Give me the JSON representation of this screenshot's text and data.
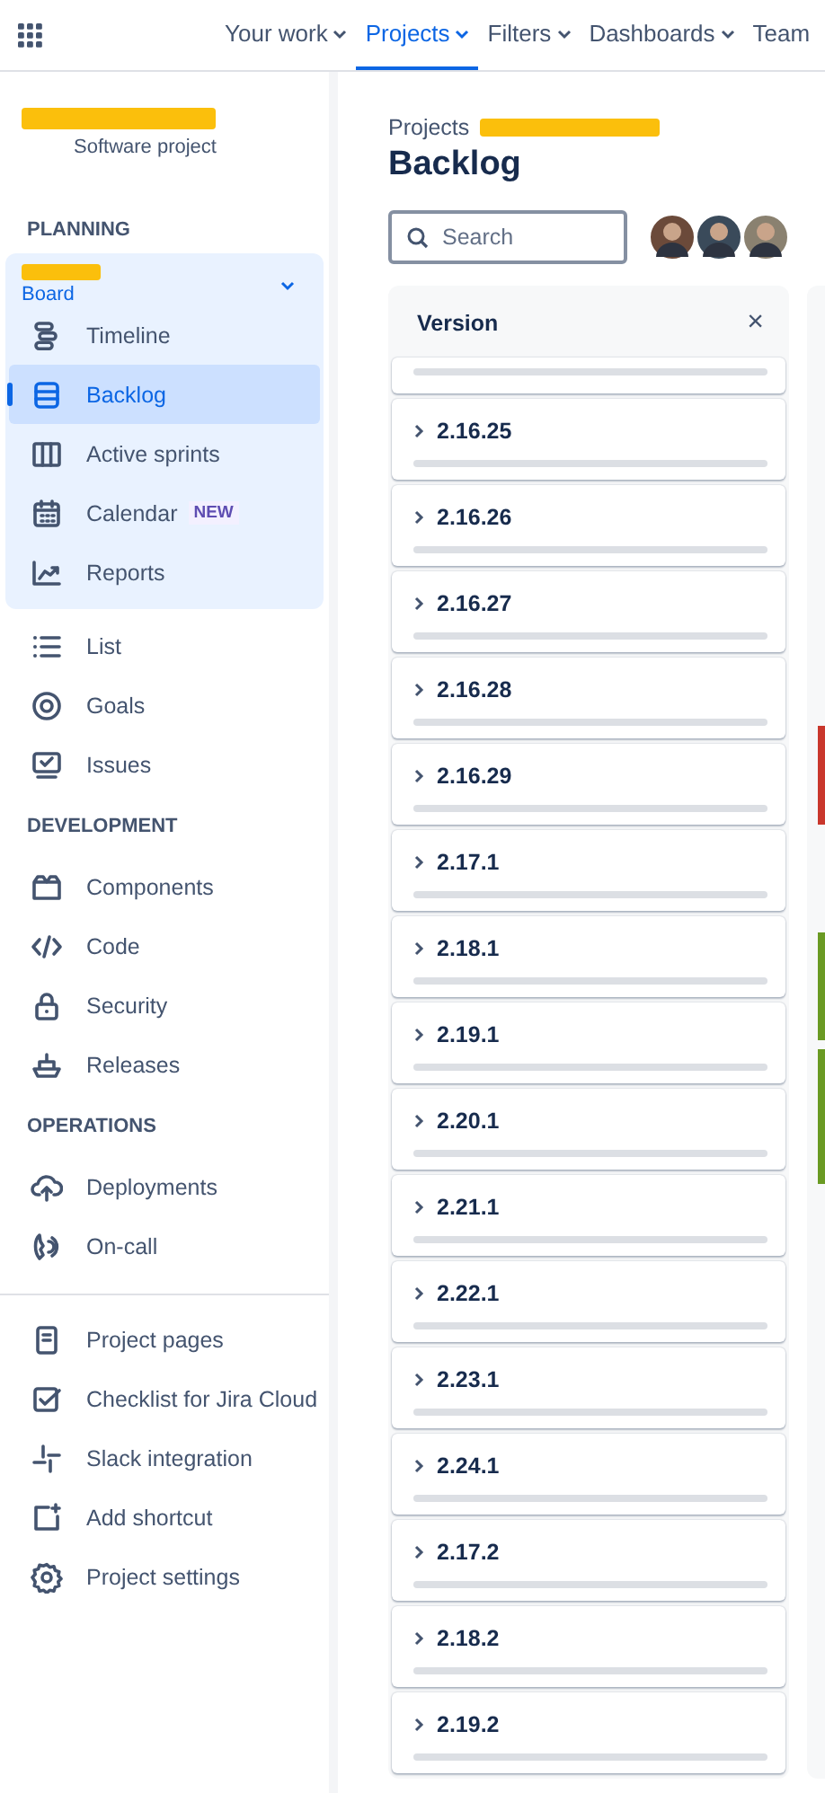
{
  "nav": {
    "items": [
      {
        "label": "Your work",
        "selected": false
      },
      {
        "label": "Projects",
        "selected": true
      },
      {
        "label": "Filters",
        "selected": false
      },
      {
        "label": "Dashboards",
        "selected": false
      },
      {
        "label": "Team",
        "selected": false
      }
    ]
  },
  "sidebar": {
    "project_type": "Software project",
    "sections": [
      {
        "heading": "PLANNING",
        "board": "Board",
        "items": [
          {
            "label": "Timeline",
            "selected": false
          },
          {
            "label": "Backlog",
            "selected": true
          },
          {
            "label": "Active sprints",
            "selected": false
          },
          {
            "label": "Calendar",
            "badge": "NEW",
            "selected": false
          },
          {
            "label": "Reports",
            "selected": false
          }
        ]
      },
      {
        "items": [
          {
            "label": "List",
            "selected": false
          },
          {
            "label": "Goals",
            "selected": false
          },
          {
            "label": "Issues",
            "selected": false
          }
        ]
      },
      {
        "heading": "DEVELOPMENT",
        "items": [
          {
            "label": "Components",
            "selected": false
          },
          {
            "label": "Code",
            "selected": false
          },
          {
            "label": "Security",
            "selected": false
          },
          {
            "label": "Releases",
            "selected": false
          }
        ]
      },
      {
        "heading": "OPERATIONS",
        "items": [
          {
            "label": "Deployments",
            "selected": false
          },
          {
            "label": "On-call",
            "selected": false
          }
        ]
      },
      {
        "divider": true,
        "items": [
          {
            "label": "Project pages",
            "selected": false
          },
          {
            "label": "Checklist for Jira Cloud",
            "selected": false
          },
          {
            "label": "Slack integration",
            "selected": false
          },
          {
            "label": "Add shortcut",
            "selected": false
          },
          {
            "label": "Project settings",
            "selected": false
          }
        ]
      }
    ]
  },
  "breadcrumb": "Projects",
  "title": "Backlog",
  "search": {
    "placeholder": "Search"
  },
  "version_panel": {
    "title": "Version",
    "close": "×",
    "versions": [
      {
        "level": 0
      },
      {
        "name": "2.16.25",
        "level": 0
      },
      {
        "name": "2.16.26",
        "level": 0
      },
      {
        "name": "2.16.27",
        "level": 0
      },
      {
        "name": "2.16.28",
        "level": 0
      },
      {
        "name": "2.16.29",
        "level": 0
      },
      {
        "name": "2.17.1",
        "level": 0
      },
      {
        "name": "2.18.1",
        "level": 0
      },
      {
        "name": "2.19.1",
        "level": 0
      },
      {
        "name": "2.20.1",
        "level": 0
      },
      {
        "name": "2.21.1",
        "level": 0
      },
      {
        "name": "2.22.1",
        "level": 0
      },
      {
        "name": "2.23.1",
        "level": 0
      },
      {
        "name": "2.24.1",
        "level": 0
      },
      {
        "name": "2.17.2",
        "level": 0
      },
      {
        "name": "2.18.2",
        "level": 0
      },
      {
        "name": "2.19.2",
        "level": 0
      }
    ]
  }
}
